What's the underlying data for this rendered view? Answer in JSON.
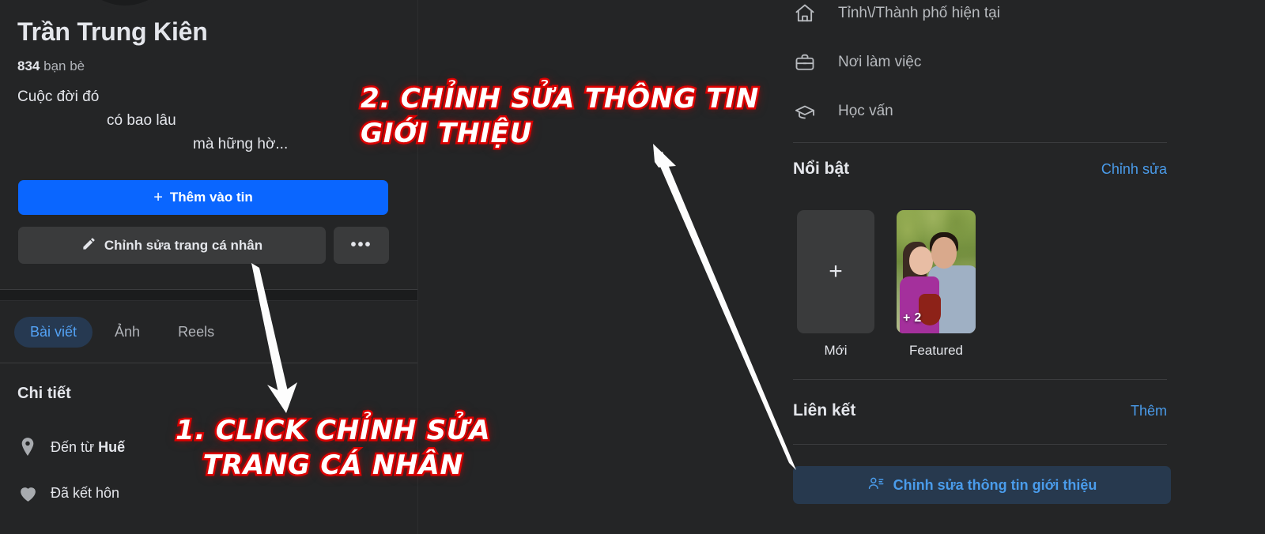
{
  "profile": {
    "name": "Trần Trung Kiên",
    "friends_count": "834",
    "friends_label": "bạn bè",
    "bio_lines": [
      "Cuộc đời đó",
      "có bao lâu",
      "mà hững hờ..."
    ]
  },
  "actions": {
    "add_story": "Thêm vào tin",
    "add_story_icon": "plus-icon",
    "edit_profile": "Chỉnh sửa trang cá nhân",
    "edit_profile_icon": "pencil-icon",
    "more": "•••",
    "more_icon": "ellipsis-icon"
  },
  "tabs": [
    {
      "label": "Bài viết",
      "active": true
    },
    {
      "label": "Ảnh",
      "active": false
    },
    {
      "label": "Reels",
      "active": false
    }
  ],
  "details": {
    "title": "Chi tiết",
    "rows": [
      {
        "icon": "location-pin-icon",
        "prefix": "Đến từ ",
        "value": "Huế"
      },
      {
        "icon": "heart-icon",
        "prefix": "Đã kết hôn",
        "value": ""
      }
    ]
  },
  "intro": {
    "rows": [
      {
        "icon": "home-icon",
        "label": "Tỉnh\\/Thành phố hiện tại"
      },
      {
        "icon": "briefcase-icon",
        "label": "Nơi làm việc"
      },
      {
        "icon": "graduation-cap-icon",
        "label": "Học vấn"
      }
    ]
  },
  "highlights": {
    "section_title": "Nổi bật",
    "section_action": "Chỉnh sửa",
    "items": [
      {
        "type": "new",
        "label": "Mới",
        "icon": "plus-icon"
      },
      {
        "type": "photo",
        "label": "Featured",
        "badge": "2",
        "badge_icon": "plus-icon"
      }
    ]
  },
  "links": {
    "section_title": "Liên kết",
    "section_action": "Thêm"
  },
  "edit_intro_button": {
    "label": "Chỉnh sửa thông tin giới thiệu",
    "icon": "user-details-icon"
  },
  "annotations": [
    {
      "id": "step-1",
      "text": "1. CLICK CHỈNH SỬA\nTRANG CÁ NHÂN"
    },
    {
      "id": "step-2",
      "text": "2. CHỈNH SỬA THÔNG TIN\nGIỚI THIỆU"
    }
  ],
  "colors": {
    "background": "#242526",
    "primary_blue": "#0a66ff",
    "accent_blue": "#4a9ceb",
    "button_gray": "#3a3b3c",
    "annotation_red": "#e00000",
    "annotation_white": "#ffffff"
  }
}
